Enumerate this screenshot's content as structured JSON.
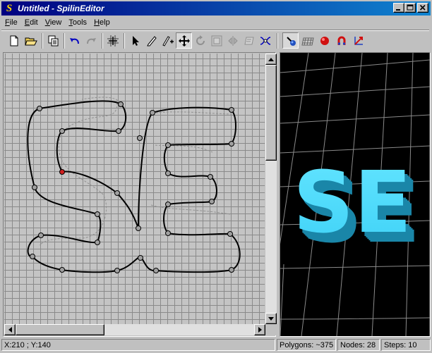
{
  "window": {
    "title": "Untitled - SpilinEditor",
    "app_icon_glyph": "S"
  },
  "menu": {
    "items": [
      {
        "accel": "F",
        "rest": "ile"
      },
      {
        "accel": "E",
        "rest": "dit"
      },
      {
        "accel": "V",
        "rest": "iew"
      },
      {
        "accel": "T",
        "rest": "ools"
      },
      {
        "accel": "H",
        "rest": "elp"
      }
    ]
  },
  "toolbar": {
    "tools": [
      {
        "name": "new-file",
        "icon": "new-file-icon"
      },
      {
        "name": "open-file",
        "icon": "open-folder-icon"
      },
      {
        "name": "copy",
        "icon": "copy-icon"
      },
      {
        "name": "undo",
        "icon": "undo-icon"
      },
      {
        "name": "redo",
        "icon": "redo-icon"
      },
      {
        "name": "grid",
        "icon": "grid-icon"
      },
      {
        "name": "select",
        "icon": "arrow-pointer-icon"
      },
      {
        "name": "pencil",
        "icon": "pencil-icon"
      },
      {
        "name": "add-node",
        "icon": "pen-plus-icon"
      },
      {
        "name": "move",
        "icon": "move-icon",
        "pressed": true
      },
      {
        "name": "rotate",
        "icon": "rotate-icon"
      },
      {
        "name": "scale",
        "icon": "scale-icon"
      },
      {
        "name": "mirror",
        "icon": "mirror-icon"
      },
      {
        "name": "skew",
        "icon": "skew-icon"
      },
      {
        "name": "smooth",
        "icon": "smooth-icon"
      },
      {
        "name": "render-mode",
        "icon": "render-icon",
        "pressed": true
      },
      {
        "name": "wireframe",
        "icon": "wireframe-icon"
      },
      {
        "name": "sphere",
        "icon": "sphere-icon"
      },
      {
        "name": "magnet",
        "icon": "magnet-icon"
      },
      {
        "name": "axes",
        "icon": "axes-icon"
      }
    ]
  },
  "preview": {
    "text": "SE",
    "face_color": "#3fd2f7",
    "side_color": "#1a86a8",
    "grid_color": "#8a8a8a"
  },
  "editor": {
    "grid_color": "#8a8a8a",
    "curve_color": "#000000",
    "selected_node_color": "#d02020"
  },
  "status": {
    "coords": "X:210 ; Y:140",
    "polygons": "Polygons: ~375",
    "nodes": "Nodes: 28",
    "steps": "Steps: 10"
  },
  "colors": {
    "title_start": "#000080",
    "title_end": "#1084d0",
    "face": "#c0c0c0"
  }
}
